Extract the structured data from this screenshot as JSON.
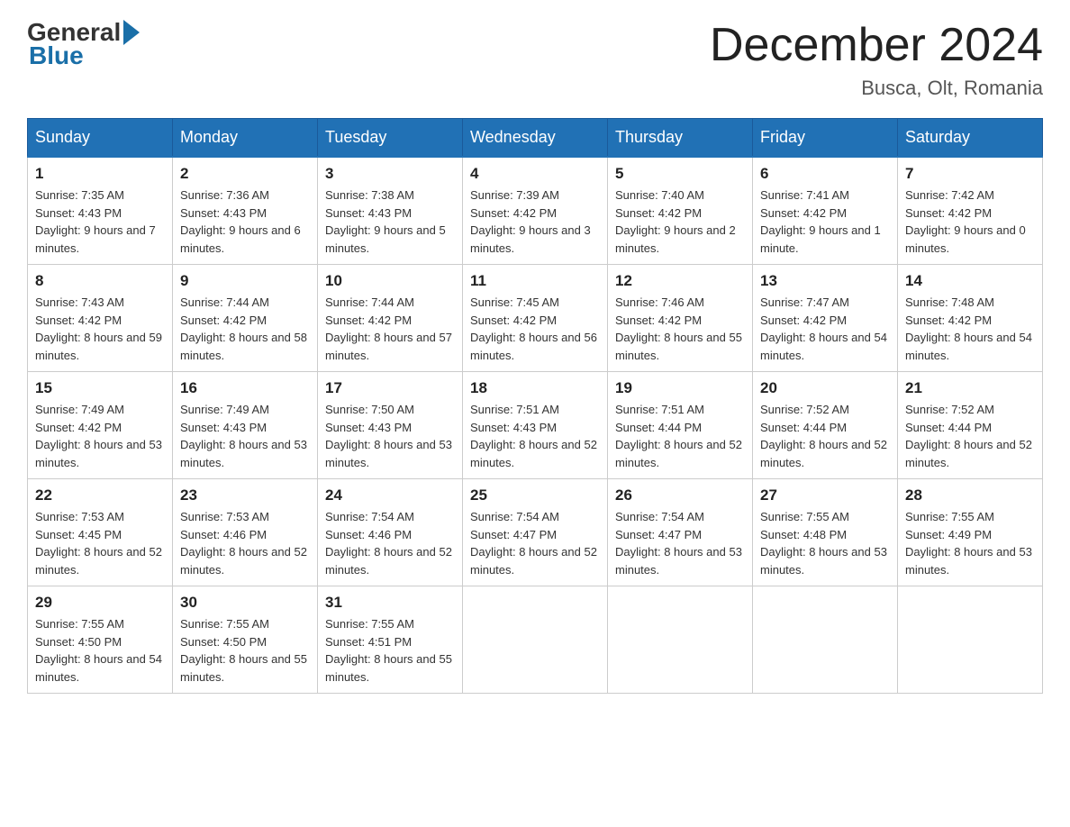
{
  "header": {
    "logo_general": "General",
    "logo_blue": "Blue",
    "title": "December 2024",
    "location": "Busca, Olt, Romania"
  },
  "days_of_week": [
    "Sunday",
    "Monday",
    "Tuesday",
    "Wednesday",
    "Thursday",
    "Friday",
    "Saturday"
  ],
  "weeks": [
    [
      {
        "day": "1",
        "sunrise": "7:35 AM",
        "sunset": "4:43 PM",
        "daylight": "9 hours and 7 minutes."
      },
      {
        "day": "2",
        "sunrise": "7:36 AM",
        "sunset": "4:43 PM",
        "daylight": "9 hours and 6 minutes."
      },
      {
        "day": "3",
        "sunrise": "7:38 AM",
        "sunset": "4:43 PM",
        "daylight": "9 hours and 5 minutes."
      },
      {
        "day": "4",
        "sunrise": "7:39 AM",
        "sunset": "4:42 PM",
        "daylight": "9 hours and 3 minutes."
      },
      {
        "day": "5",
        "sunrise": "7:40 AM",
        "sunset": "4:42 PM",
        "daylight": "9 hours and 2 minutes."
      },
      {
        "day": "6",
        "sunrise": "7:41 AM",
        "sunset": "4:42 PM",
        "daylight": "9 hours and 1 minute."
      },
      {
        "day": "7",
        "sunrise": "7:42 AM",
        "sunset": "4:42 PM",
        "daylight": "9 hours and 0 minutes."
      }
    ],
    [
      {
        "day": "8",
        "sunrise": "7:43 AM",
        "sunset": "4:42 PM",
        "daylight": "8 hours and 59 minutes."
      },
      {
        "day": "9",
        "sunrise": "7:44 AM",
        "sunset": "4:42 PM",
        "daylight": "8 hours and 58 minutes."
      },
      {
        "day": "10",
        "sunrise": "7:44 AM",
        "sunset": "4:42 PM",
        "daylight": "8 hours and 57 minutes."
      },
      {
        "day": "11",
        "sunrise": "7:45 AM",
        "sunset": "4:42 PM",
        "daylight": "8 hours and 56 minutes."
      },
      {
        "day": "12",
        "sunrise": "7:46 AM",
        "sunset": "4:42 PM",
        "daylight": "8 hours and 55 minutes."
      },
      {
        "day": "13",
        "sunrise": "7:47 AM",
        "sunset": "4:42 PM",
        "daylight": "8 hours and 54 minutes."
      },
      {
        "day": "14",
        "sunrise": "7:48 AM",
        "sunset": "4:42 PM",
        "daylight": "8 hours and 54 minutes."
      }
    ],
    [
      {
        "day": "15",
        "sunrise": "7:49 AM",
        "sunset": "4:42 PM",
        "daylight": "8 hours and 53 minutes."
      },
      {
        "day": "16",
        "sunrise": "7:49 AM",
        "sunset": "4:43 PM",
        "daylight": "8 hours and 53 minutes."
      },
      {
        "day": "17",
        "sunrise": "7:50 AM",
        "sunset": "4:43 PM",
        "daylight": "8 hours and 53 minutes."
      },
      {
        "day": "18",
        "sunrise": "7:51 AM",
        "sunset": "4:43 PM",
        "daylight": "8 hours and 52 minutes."
      },
      {
        "day": "19",
        "sunrise": "7:51 AM",
        "sunset": "4:44 PM",
        "daylight": "8 hours and 52 minutes."
      },
      {
        "day": "20",
        "sunrise": "7:52 AM",
        "sunset": "4:44 PM",
        "daylight": "8 hours and 52 minutes."
      },
      {
        "day": "21",
        "sunrise": "7:52 AM",
        "sunset": "4:44 PM",
        "daylight": "8 hours and 52 minutes."
      }
    ],
    [
      {
        "day": "22",
        "sunrise": "7:53 AM",
        "sunset": "4:45 PM",
        "daylight": "8 hours and 52 minutes."
      },
      {
        "day": "23",
        "sunrise": "7:53 AM",
        "sunset": "4:46 PM",
        "daylight": "8 hours and 52 minutes."
      },
      {
        "day": "24",
        "sunrise": "7:54 AM",
        "sunset": "4:46 PM",
        "daylight": "8 hours and 52 minutes."
      },
      {
        "day": "25",
        "sunrise": "7:54 AM",
        "sunset": "4:47 PM",
        "daylight": "8 hours and 52 minutes."
      },
      {
        "day": "26",
        "sunrise": "7:54 AM",
        "sunset": "4:47 PM",
        "daylight": "8 hours and 53 minutes."
      },
      {
        "day": "27",
        "sunrise": "7:55 AM",
        "sunset": "4:48 PM",
        "daylight": "8 hours and 53 minutes."
      },
      {
        "day": "28",
        "sunrise": "7:55 AM",
        "sunset": "4:49 PM",
        "daylight": "8 hours and 53 minutes."
      }
    ],
    [
      {
        "day": "29",
        "sunrise": "7:55 AM",
        "sunset": "4:50 PM",
        "daylight": "8 hours and 54 minutes."
      },
      {
        "day": "30",
        "sunrise": "7:55 AM",
        "sunset": "4:50 PM",
        "daylight": "8 hours and 55 minutes."
      },
      {
        "day": "31",
        "sunrise": "7:55 AM",
        "sunset": "4:51 PM",
        "daylight": "8 hours and 55 minutes."
      },
      null,
      null,
      null,
      null
    ]
  ],
  "labels": {
    "sunrise": "Sunrise:",
    "sunset": "Sunset:",
    "daylight": "Daylight:"
  }
}
